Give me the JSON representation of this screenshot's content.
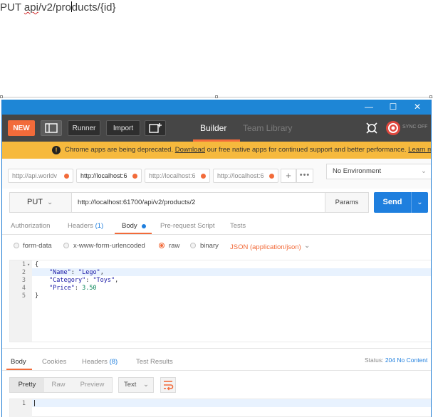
{
  "doc": {
    "method_text": "PUT ",
    "url_misspelled": "api",
    "url_before_caret": "/v2/pro",
    "url_after_caret": "ducts/{id}"
  },
  "window": {
    "minimize": "—",
    "maximize": "☐",
    "close": "✕"
  },
  "toolbar": {
    "new_label": "NEW",
    "runner_label": "Runner",
    "import_label": "Import",
    "builder_tab": "Builder",
    "team_library_tab": "Team Library",
    "sync_label": "SYNC OFF"
  },
  "banner": {
    "text_before": "Chrome apps are being deprecated. ",
    "download_link": "Download",
    "text_middle": " our free native apps for continued support and better performance. ",
    "learn_more_link": "Learn more",
    "warning_glyph": "!"
  },
  "request_tabs": [
    {
      "label": "http://api.worldv"
    },
    {
      "label": "http://localhost:6"
    },
    {
      "label": "http://localhost:6"
    },
    {
      "label": "http://localhost:6"
    }
  ],
  "tab_add": "+",
  "tab_more": "•••",
  "environment": {
    "selected": "No Environment"
  },
  "request": {
    "method": "PUT",
    "url": "http://localhost:61700/api/v2/products/2",
    "params_label": "Params",
    "send_label": "Send"
  },
  "request_subtabs": {
    "authorization": "Authorization",
    "headers": "Headers",
    "headers_count": "(1)",
    "body": "Body",
    "pre_request": "Pre-request Script",
    "tests": "Tests"
  },
  "body_modes": {
    "form_data": "form-data",
    "urlencoded": "x-www-form-urlencoded",
    "raw": "raw",
    "binary": "binary",
    "content_type": "JSON (application/json)"
  },
  "editor": {
    "line_numbers": [
      "1",
      "2",
      "3",
      "4",
      "5"
    ],
    "lines": {
      "l1": "{",
      "l2_key": "\"Name\"",
      "l2_sep": ": ",
      "l2_val": "\"Lego\"",
      "l2_end": ",",
      "l3_key": "\"Category\"",
      "l3_sep": ": ",
      "l3_val": "\"Toys\"",
      "l3_end": ",",
      "l4_key": "\"Price\"",
      "l4_sep": ": ",
      "l4_val": "3.50",
      "l5": "}"
    }
  },
  "response_tabs": {
    "body": "Body",
    "cookies": "Cookies",
    "headers": "Headers",
    "headers_count": "(8)",
    "test_results": "Test Results"
  },
  "response_status": {
    "label": "Status: ",
    "code": "204 No Content"
  },
  "response_view": {
    "pretty": "Pretty",
    "raw": "Raw",
    "preview": "Preview",
    "format_select": "Text"
  },
  "response_editor": {
    "line_number": "1"
  },
  "colors": {
    "accent_orange": "#f26b3a",
    "primary_blue": "#1f7fde",
    "titlebar_blue": "#1e86d6",
    "toolbar_dark": "#464646",
    "banner_yellow": "#f6b93d"
  }
}
